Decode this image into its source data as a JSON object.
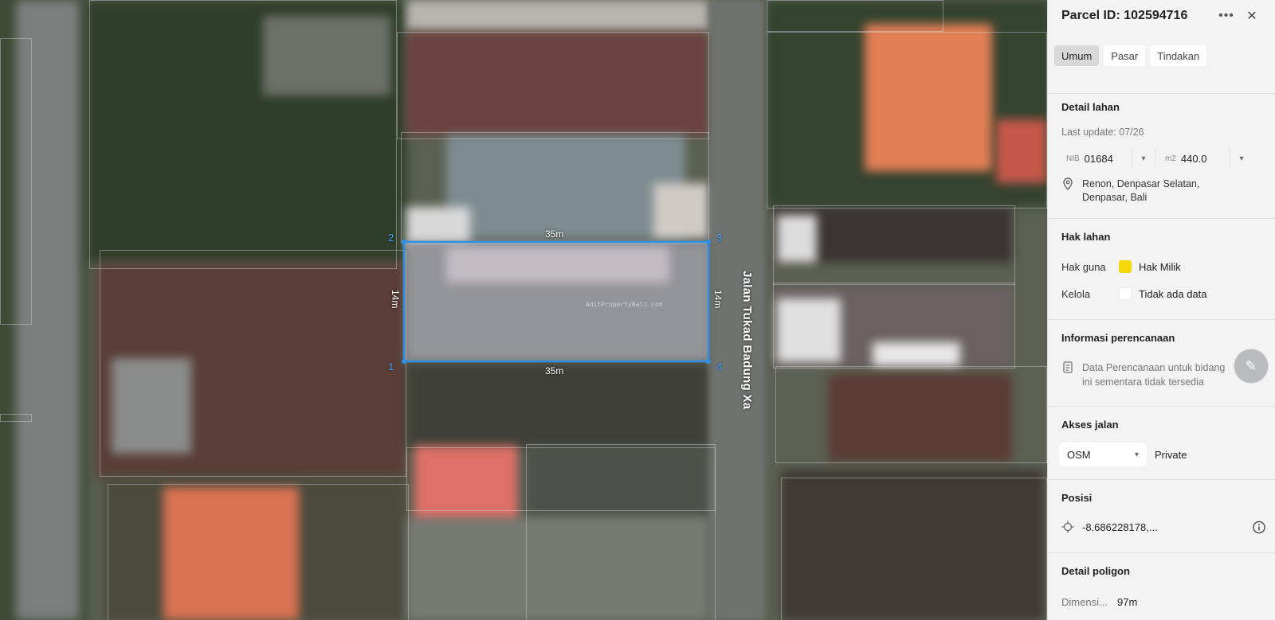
{
  "map": {
    "road_label": "Jalan Tukad Badung Xa",
    "watermark": "AditPropertyBali.com",
    "dimensions": {
      "top": "35m",
      "bottom": "35m",
      "left": "14m",
      "right": "14m"
    },
    "corners": [
      "1",
      "2",
      "3",
      "4"
    ],
    "highlight_color": "#2e8fe6"
  },
  "panel": {
    "title": "Parcel ID: 102594716",
    "more_icon": "more-horizontal-icon",
    "close_icon": "close-icon",
    "tabs": [
      {
        "label": "Umum",
        "active": true
      },
      {
        "label": "Pasar",
        "active": false
      },
      {
        "label": "Tindakan",
        "active": false
      }
    ],
    "detail_lahan": {
      "title": "Detail lahan",
      "last_update": "Last update: 07/26",
      "nib_label": "NIB",
      "nib_value": "01684",
      "area_label": "m2",
      "area_value": "440.0",
      "address_line1": "Renon, Denpasar Selatan,",
      "address_line2": "Denpasar, Bali"
    },
    "hak_lahan": {
      "title": "Hak lahan",
      "rows": [
        {
          "key": "Hak guna",
          "value": "Hak Milik",
          "color": "#f5d90a"
        },
        {
          "key": "Kelola",
          "value": "Tidak ada data",
          "color": "#ffffff"
        }
      ]
    },
    "informasi_perencanaan": {
      "title": "Informasi perencanaan",
      "text_line1": "Data Perencanaan untuk bidang",
      "text_line2": "ini sementara tidak tersedia"
    },
    "akses_jalan": {
      "title": "Akses jalan",
      "source": "OSM",
      "value": "Private"
    },
    "posisi": {
      "title": "Posisi",
      "value": "-8.686228178,..."
    },
    "detail_poligon": {
      "title": "Detail poligon",
      "key": "Dimensi...",
      "value": "97m"
    }
  }
}
